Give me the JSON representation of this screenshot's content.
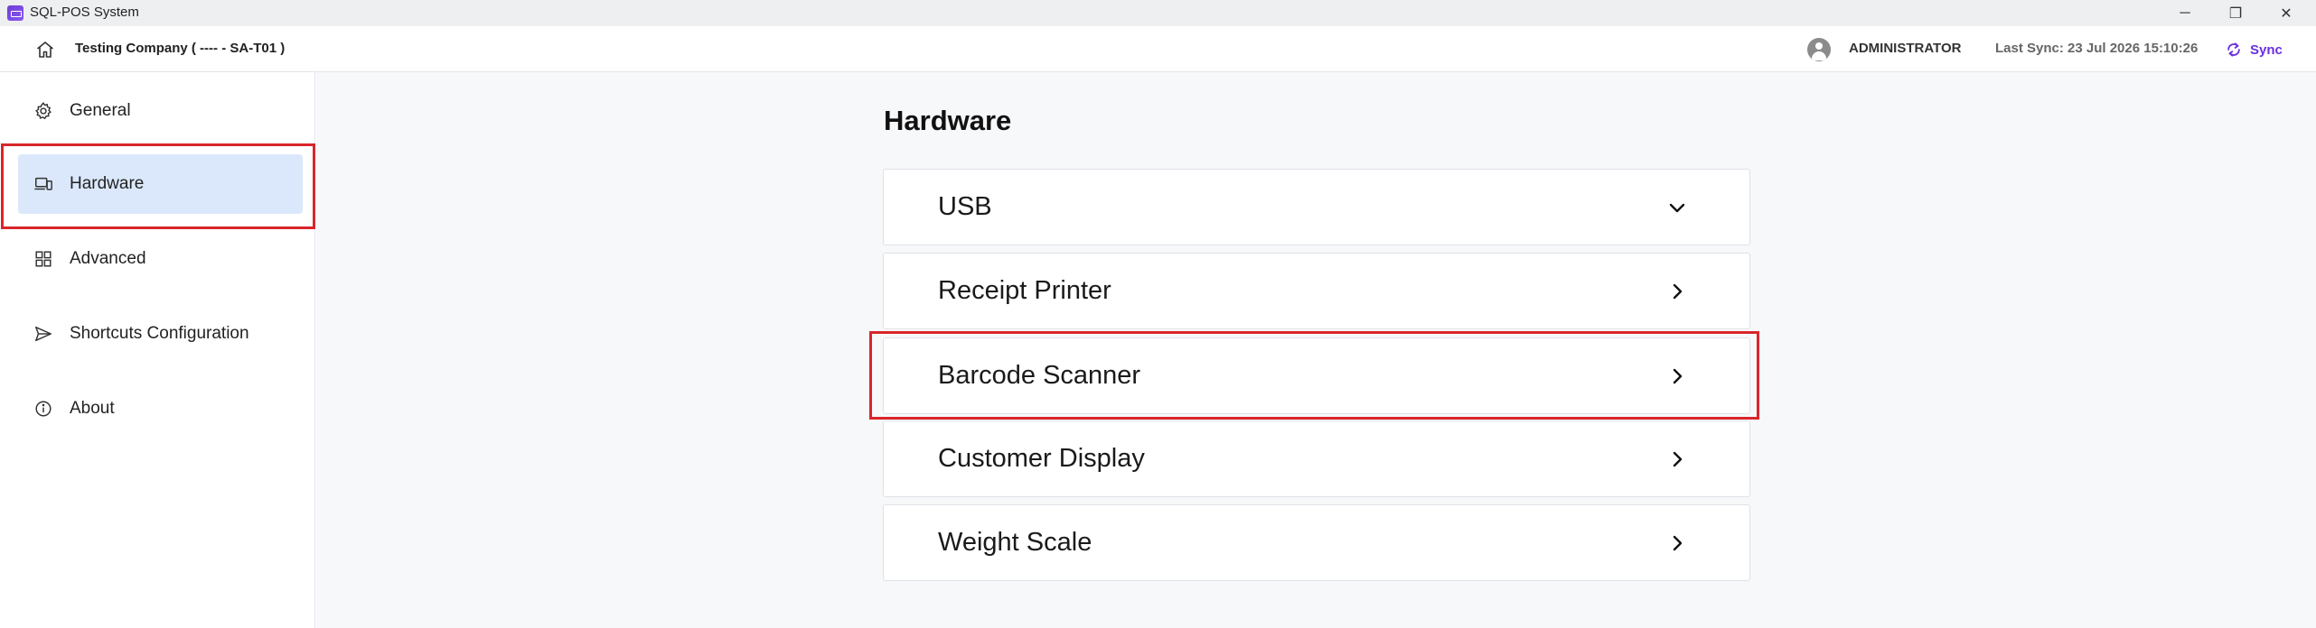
{
  "window": {
    "title": "SQL-POS System",
    "controls": {
      "minimize": "─",
      "maximize": "❐",
      "close": "✕"
    }
  },
  "header": {
    "company": "Testing Company ( ---- - SA-T01 )",
    "user": "ADMINISTRATOR",
    "last_sync": "Last Sync: 23 Jul 2026 15:10:26",
    "sync_label": "Sync"
  },
  "sidebar": {
    "items": [
      {
        "label": "General",
        "icon": "gear-icon"
      },
      {
        "label": "Hardware",
        "icon": "devices-icon",
        "active": true
      },
      {
        "label": "Advanced",
        "icon": "grid-icon"
      },
      {
        "label": "Shortcuts Configuration",
        "icon": "send-icon"
      },
      {
        "label": "About",
        "icon": "info-icon"
      }
    ]
  },
  "main": {
    "title": "Hardware",
    "sections": [
      {
        "label": "USB",
        "icon": "chevron-down-icon"
      },
      {
        "label": "Receipt Printer",
        "icon": "chevron-right-icon"
      },
      {
        "label": "Barcode Scanner",
        "icon": "chevron-right-icon",
        "highlighted": true
      },
      {
        "label": "Customer Display",
        "icon": "chevron-right-icon"
      },
      {
        "label": "Weight Scale",
        "icon": "chevron-right-icon"
      }
    ]
  },
  "colors": {
    "accent": "#6a2fe0",
    "active_nav_bg": "#dbe8fb",
    "highlight_border": "#d9252b",
    "main_bg": "#f7f8fa"
  }
}
